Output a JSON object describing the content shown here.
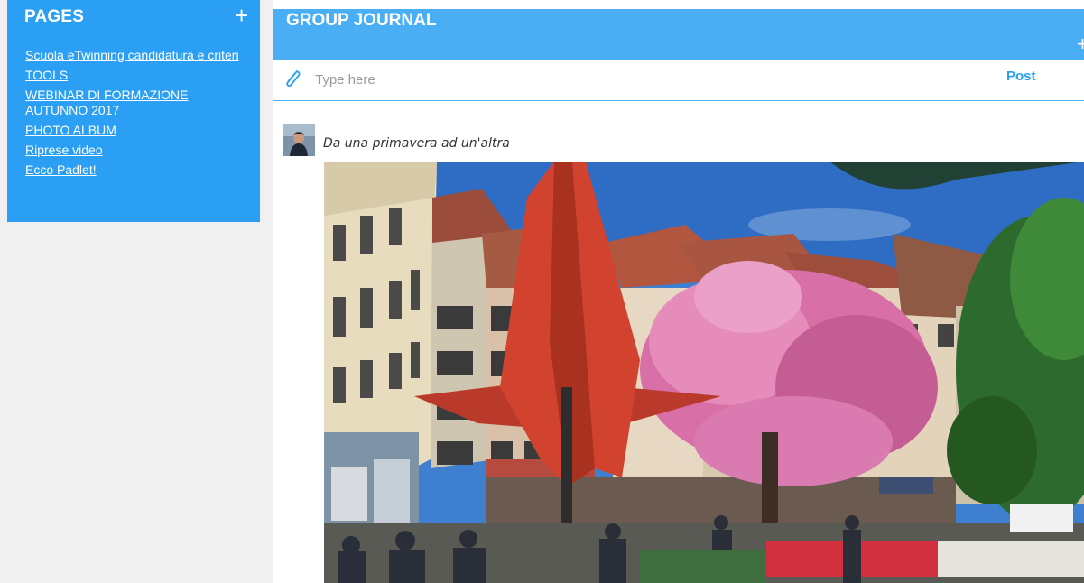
{
  "sidebar": {
    "title": "PAGES",
    "add_glyph": "+",
    "items": [
      {
        "label": "Scuola eTwinning candidatura e criteri"
      },
      {
        "label": "TOOLS"
      },
      {
        "label": "WEBINAR DI FORMAZIONE AUTUNNO 2017"
      },
      {
        "label": "PHOTO ALBUM"
      },
      {
        "label": "Riprese video"
      },
      {
        "label": "Ecco Padlet!"
      }
    ]
  },
  "journal": {
    "title": "GROUP JOURNAL",
    "add_glyph": "+",
    "composer": {
      "placeholder": "Type here",
      "post_label": "Post",
      "attach_icon": "paperclip-icon"
    },
    "entry": {
      "text": "Da una primavera ad un'altra",
      "avatar_icon": "user-avatar",
      "photo_icon": "street-photo"
    }
  },
  "colors": {
    "sidebar_bg": "#2a9ff4",
    "header_bg": "#4aaef5",
    "accent": "#2a9ff4",
    "page_bg": "#f0f0f0"
  }
}
